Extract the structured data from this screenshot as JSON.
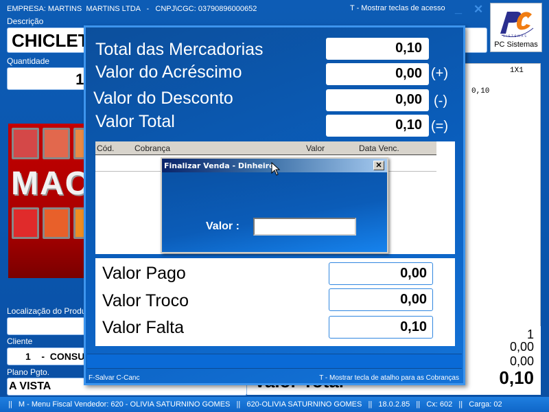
{
  "header": {
    "company_line": "EMPRESA: MARTINS  MARTINS LTDA   -   CNPJ\\CGC: 03790896000652",
    "shortcut_hint": "T - Mostrar teclas de acesso",
    "minimize_glyph": "_",
    "close_glyph": "✕",
    "logo_label": "PC Sistemas",
    "logo_colors": {
      "primary": "#2b2f8f",
      "accent": "#f07d12"
    }
  },
  "product": {
    "description_label": "Descrição",
    "description_value": "CHICLETE",
    "quantity_label": "Quantidade",
    "quantity_value": "1,00"
  },
  "banner": {
    "text": "MAC"
  },
  "customer": {
    "location_label": "Localização do Produto",
    "location_value": "",
    "client_label": "Cliente",
    "client_value": "1    -  CONSUMIDOR",
    "plan_label": "Plano Pgto.",
    "plan_value": "A VISTA"
  },
  "coupon": {
    "header": "1X1",
    "line_value": "0,10",
    "summary": [
      "1",
      "0,00",
      "0,00",
      "0,10"
    ],
    "total_label": "Valor Total"
  },
  "payment_dialog": {
    "summary": [
      {
        "label": "Total das Mercadorias",
        "value": "0,10",
        "op": ""
      },
      {
        "label": "Valor do Acréscimo",
        "value": "0,00",
        "op": "(+)"
      },
      {
        "label": "Valor do Desconto",
        "value": "0,00",
        "op": "(-)"
      },
      {
        "label": "Valor Total",
        "value": "0,10",
        "op": "(=)"
      }
    ],
    "grid_columns": [
      "Cód.",
      "Cobrança",
      "Valor",
      "Data Venc."
    ],
    "payments": [
      {
        "label": "Valor Pago",
        "value": "0,00"
      },
      {
        "label": "Valor Troco",
        "value": "0,00"
      },
      {
        "label": "Valor Falta",
        "value": "0,10"
      }
    ],
    "footer_left": "F-Salvar C-Canc",
    "footer_right": "T - Mostrar tecla de atalho para as Cobranças"
  },
  "cash_dialog": {
    "title": "Finalizar Venda - Dinheiro",
    "close_glyph": "✕",
    "value_label": "Valor :",
    "value_input": ""
  },
  "statusbar": {
    "text": "||   M - Menu Fiscal Vendedor: 620 - OLIVIA SATURNINO GOMES   ||   620-OLIVIA SATURNINO GOMES   ||   18.0.2.85   ||   Cx: 602   ||   Carga: 02"
  }
}
